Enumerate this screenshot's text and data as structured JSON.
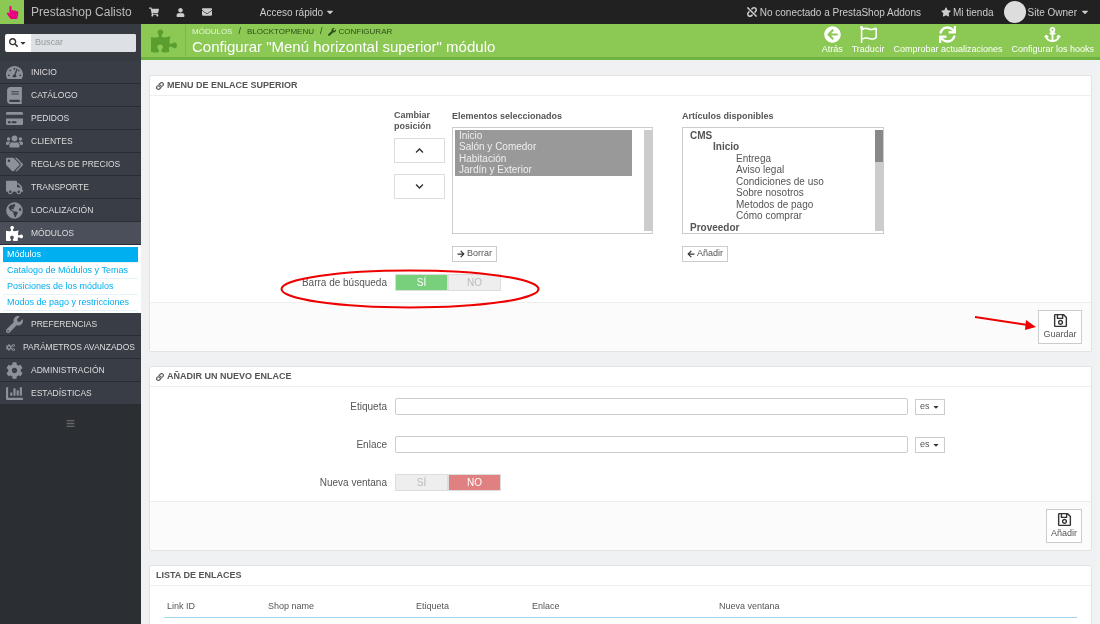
{
  "topbar": {
    "brand": "Prestashop Calisto",
    "quick_access": "Acceso rápido",
    "addons": "No conectado a PrestaShop Addons",
    "shop": "Mi tienda",
    "user": "Site Owner"
  },
  "search": {
    "placeholder": "Buscar"
  },
  "sidebar": {
    "items": [
      {
        "label": "INICIO",
        "selected": false
      },
      {
        "label": "CATÁLOGO",
        "selected": false
      },
      {
        "label": "PEDIDOS",
        "selected": false
      },
      {
        "label": "CLIENTES",
        "selected": false
      },
      {
        "label": "REGLAS DE PRECIOS",
        "selected": false
      },
      {
        "label": "TRANSPORTE",
        "selected": false
      },
      {
        "label": "LOCALIZACIÓN",
        "selected": false
      },
      {
        "label": "MÓDULOS",
        "selected": true,
        "children": [
          {
            "label": "Módulos",
            "selected": true
          },
          {
            "label": "Catalogo de Módulos y Temas",
            "selected": false
          },
          {
            "label": "Posiciones de los módulos",
            "selected": false
          },
          {
            "label": "Modos de pago y restricciones",
            "selected": false
          }
        ]
      },
      {
        "label": "PREFERENCIAS",
        "selected": false
      },
      {
        "label": "PARÁMETROS AVANZADOS",
        "selected": false
      },
      {
        "label": "ADMINISTRACIÓN",
        "selected": false
      },
      {
        "label": "ESTADÍSTICAS",
        "selected": false
      }
    ]
  },
  "header": {
    "breadcrumb": [
      "MÓDULOS",
      "BLOCKTOPMENU",
      "CONFIGURAR"
    ],
    "separator": "/",
    "title": "Configurar \"Menú horizontal superior\" módulo",
    "actions": [
      "Atrás",
      "Traducir",
      "Comprobar actualizaciones",
      "Configurar los hooks"
    ]
  },
  "menu_panel": {
    "title": "MENU DE ENLACE SUPERIOR",
    "position_label": "Cambiar posición",
    "selected_label": "Elementos seleccionados",
    "selected_items": [
      {
        "label": "Inicio",
        "selected": true
      },
      {
        "label": "Salón y Comedor",
        "selected": true
      },
      {
        "label": "Habitación",
        "selected": true
      },
      {
        "label": "Jardín y Exterior",
        "selected": true
      }
    ],
    "available_label": "Artículos disponibles",
    "available_items": [
      {
        "label": "CMS",
        "children": [
          {
            "label": "Inicio",
            "children": [
              {
                "label": "Entrega"
              },
              {
                "label": "Aviso legal"
              },
              {
                "label": "Condiciones de uso"
              },
              {
                "label": "Sobre nosotros"
              },
              {
                "label": "Metodos de pago"
              },
              {
                "label": "Cómo comprar"
              }
            ]
          }
        ]
      },
      {
        "label": "Proveedor"
      }
    ],
    "remove_button": "Borrar",
    "add_button": "Añadir",
    "search_bar": {
      "label": "Barra de búsqueda",
      "options": [
        {
          "label": "SÍ",
          "selected": true
        },
        {
          "label": "NO",
          "selected": false
        }
      ]
    },
    "save_button": "Guardar"
  },
  "new_link_panel": {
    "title": "AÑADIR UN NUEVO ENLACE",
    "fields": [
      {
        "label": "Etiqueta",
        "language": "es"
      },
      {
        "label": "Enlace",
        "language": "es"
      }
    ],
    "new_window": {
      "label": "Nueva ventana",
      "options": [
        {
          "label": "SÍ",
          "selected": false
        },
        {
          "label": "NO",
          "selected": true
        }
      ]
    },
    "add_button": "Añadir"
  },
  "links_panel": {
    "title": "LISTA DE ENLACES",
    "columns": [
      "Link ID",
      "Shop name",
      "Etiqueta",
      "Enlace",
      "Nueva ventana"
    ]
  }
}
